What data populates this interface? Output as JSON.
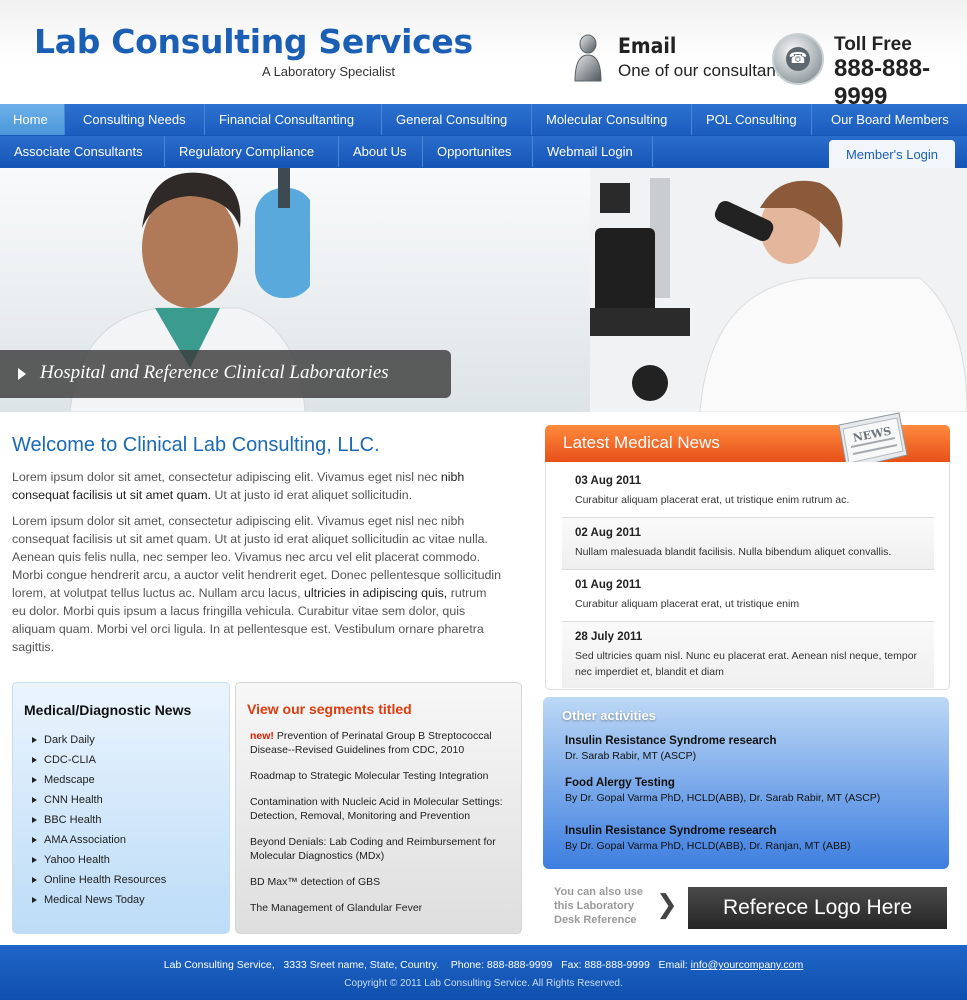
{
  "header": {
    "title": "Lab Consulting Services",
    "tagline": "A Laboratory Specialist",
    "email_label": "Email",
    "email_sub": "One of our consultant",
    "tollfree_label": "Toll Free",
    "tollfree_number": "888-888-9999"
  },
  "nav": {
    "row1": [
      "Home",
      "Consulting Needs",
      "Financial Consultanting",
      "General Consulting",
      "Molecular Consulting",
      "POL Consulting",
      "Our Board Members"
    ],
    "row2": [
      "Associate Consultants",
      "Regulatory Compliance",
      "About Us",
      "Opportunites",
      "Webmail Login"
    ],
    "members_login": "Member's Login",
    "active": "Home"
  },
  "hero": {
    "caption": "Hospital and Reference Clinical Laboratories"
  },
  "welcome": {
    "title": "Welcome to Clinical Lab Consulting, LLC.",
    "p1_a": "Lorem ipsum dolor sit amet, consectetur adipiscing elit. Vivamus eget nisl nec ",
    "p1_b": "nibh consequat facilisis ut sit amet quam.",
    "p1_c": " Ut at justo id erat aliquet sollicitudin.",
    "p2_a": "Lorem ipsum dolor sit amet, consectetur adipiscing elit. Vivamus eget nisl nec nibh consequat facilisis ut sit amet quam. Ut at justo id erat aliquet sollicitudin ac vitae nulla. Aenean quis felis nulla, nec semper leo. Vivamus nec arcu vel elit placerat commodo. Morbi congue hendrerit arcu, a auctor velit hendrerit eget. Donec pellentesque sollicitudin lorem, at volutpat tellus luctus ac. Nullam arcu lacus, ",
    "p2_b": "ultricies in adipiscing quis,",
    "p2_c": " rutrum eu dolor. Morbi quis ipsum a lacus fringilla vehicula. Curabitur vitae sem dolor, quis aliquam quam. Morbi vel orci ligula. In at pellentesque est. Vestibulum ornare pharetra sagittis."
  },
  "news": {
    "title": "Latest Medical News",
    "items": [
      {
        "date": "03 Aug 2011",
        "text": "Curabitur aliquam placerat erat, ut tristique enim rutrum ac."
      },
      {
        "date": "02 Aug 2011",
        "text": "Nullam malesuada blandit facilisis. Nulla bibendum aliquet convallis."
      },
      {
        "date": "01 Aug 2011",
        "text": "Curabitur aliquam placerat erat, ut tristique enim"
      },
      {
        "date": "28 July 2011",
        "text": "Sed ultricies quam nisl. Nunc eu placerat erat. Aenean nisl neque, tempor nec imperdiet et, blandit et diam"
      }
    ]
  },
  "medical": {
    "title": "Medical/Diagnostic News",
    "links": [
      "Dark Daily",
      "CDC-CLIA",
      "Medscape",
      "CNN Health",
      "BBC Health",
      "AMA Association",
      "Yahoo Health",
      "Online Health Resources",
      "Medical News Today"
    ]
  },
  "segments": {
    "title": "View our segments titled",
    "new_tag": "new!",
    "items": [
      "Prevention of Perinatal Group B Streptococcal Disease--Revised Guidelines from CDC, 2010",
      "Roadmap to Strategic Molecular Testing Integration",
      "Contamination with Nucleic Acid in Molecular Settings: Detection, Removal, Monitoring and Prevention",
      "Beyond Denials: Lab Coding and Reimbursement for Molecular Diagnostics (MDx)",
      "BD Max™ detection of GBS",
      "The Management of Glandular Fever"
    ]
  },
  "other": {
    "title": "Other activities",
    "items": [
      {
        "title": "Insulin Resistance Syndrome research",
        "sub": "Dr. Sarab Rabir, MT (ASCP)"
      },
      {
        "title": "Food Alergy Testing",
        "sub": "By Dr. Gopal Varma PhD, HCLD(ABB), Dr. Sarab Rabir, MT (ASCP)"
      },
      {
        "title": "Insulin Resistance Syndrome research",
        "sub": "By Dr. Gopal Varma PhD, HCLD(ABB), Dr. Ranjan, MT (ABB)"
      }
    ]
  },
  "reference": {
    "text": "You can also use this Laboratory Desk Reference",
    "logo": "Referece Logo Here"
  },
  "footer": {
    "line1_a": "Lab Consulting Service,   3333 Sreet name, State, Country.    Phone: 888-888-9999   Fax: 888-888-9999   Email: ",
    "email": "info@yourcompany.com",
    "line2": "Copyright © 2011  Lab Consulting Service. All Rights Reserved."
  },
  "colors": {
    "brand_blue": "#1a5fb4",
    "nav_blue": "#1a5cbe",
    "news_orange": "#e8501a",
    "segments_red": "#e03b0c"
  }
}
